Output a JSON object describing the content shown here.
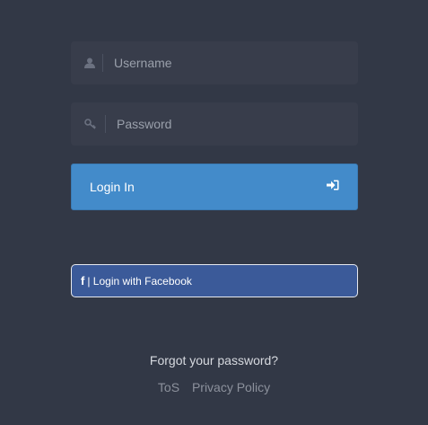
{
  "login_form": {
    "username": {
      "placeholder": "Username",
      "value": "",
      "icon": "user-icon"
    },
    "password": {
      "placeholder": "Password",
      "value": "",
      "icon": "key-icon"
    },
    "login_button": {
      "label": "Login In",
      "icon": "sign-in-icon"
    },
    "facebook_button": {
      "label": "| Login with Facebook",
      "icon": "facebook-icon"
    }
  },
  "footer": {
    "forgot_password": "Forgot your password?",
    "links": [
      {
        "label": "ToS"
      },
      {
        "label": "Privacy Policy"
      }
    ]
  },
  "colors": {
    "background": "#323846",
    "field": "#383d4b",
    "login_button": "#438bca",
    "facebook_button": "#3b5a99"
  }
}
